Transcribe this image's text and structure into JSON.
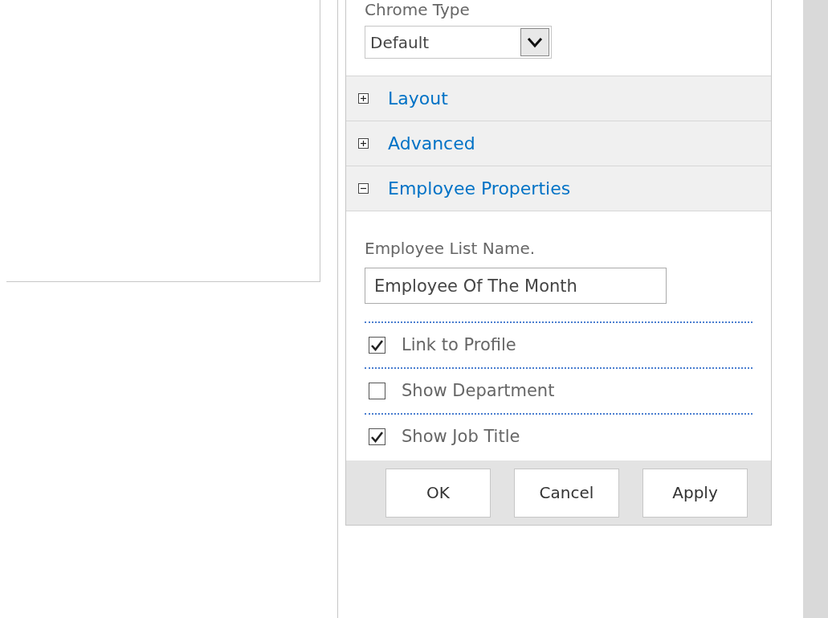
{
  "chrome_type": {
    "label": "Chrome Type",
    "value": "Default"
  },
  "sections": [
    {
      "title": "Layout",
      "expanded": false
    },
    {
      "title": "Advanced",
      "expanded": false
    },
    {
      "title": "Employee Properties",
      "expanded": true
    }
  ],
  "employee_list_name": {
    "label": "Employee List Name.",
    "value": "Employee Of The Month"
  },
  "options": [
    {
      "label": "Link to Profile",
      "checked": true
    },
    {
      "label": "Show Department",
      "checked": false
    },
    {
      "label": "Show Job Title",
      "checked": true
    }
  ],
  "buttons": [
    "OK",
    "Cancel",
    "Apply"
  ]
}
